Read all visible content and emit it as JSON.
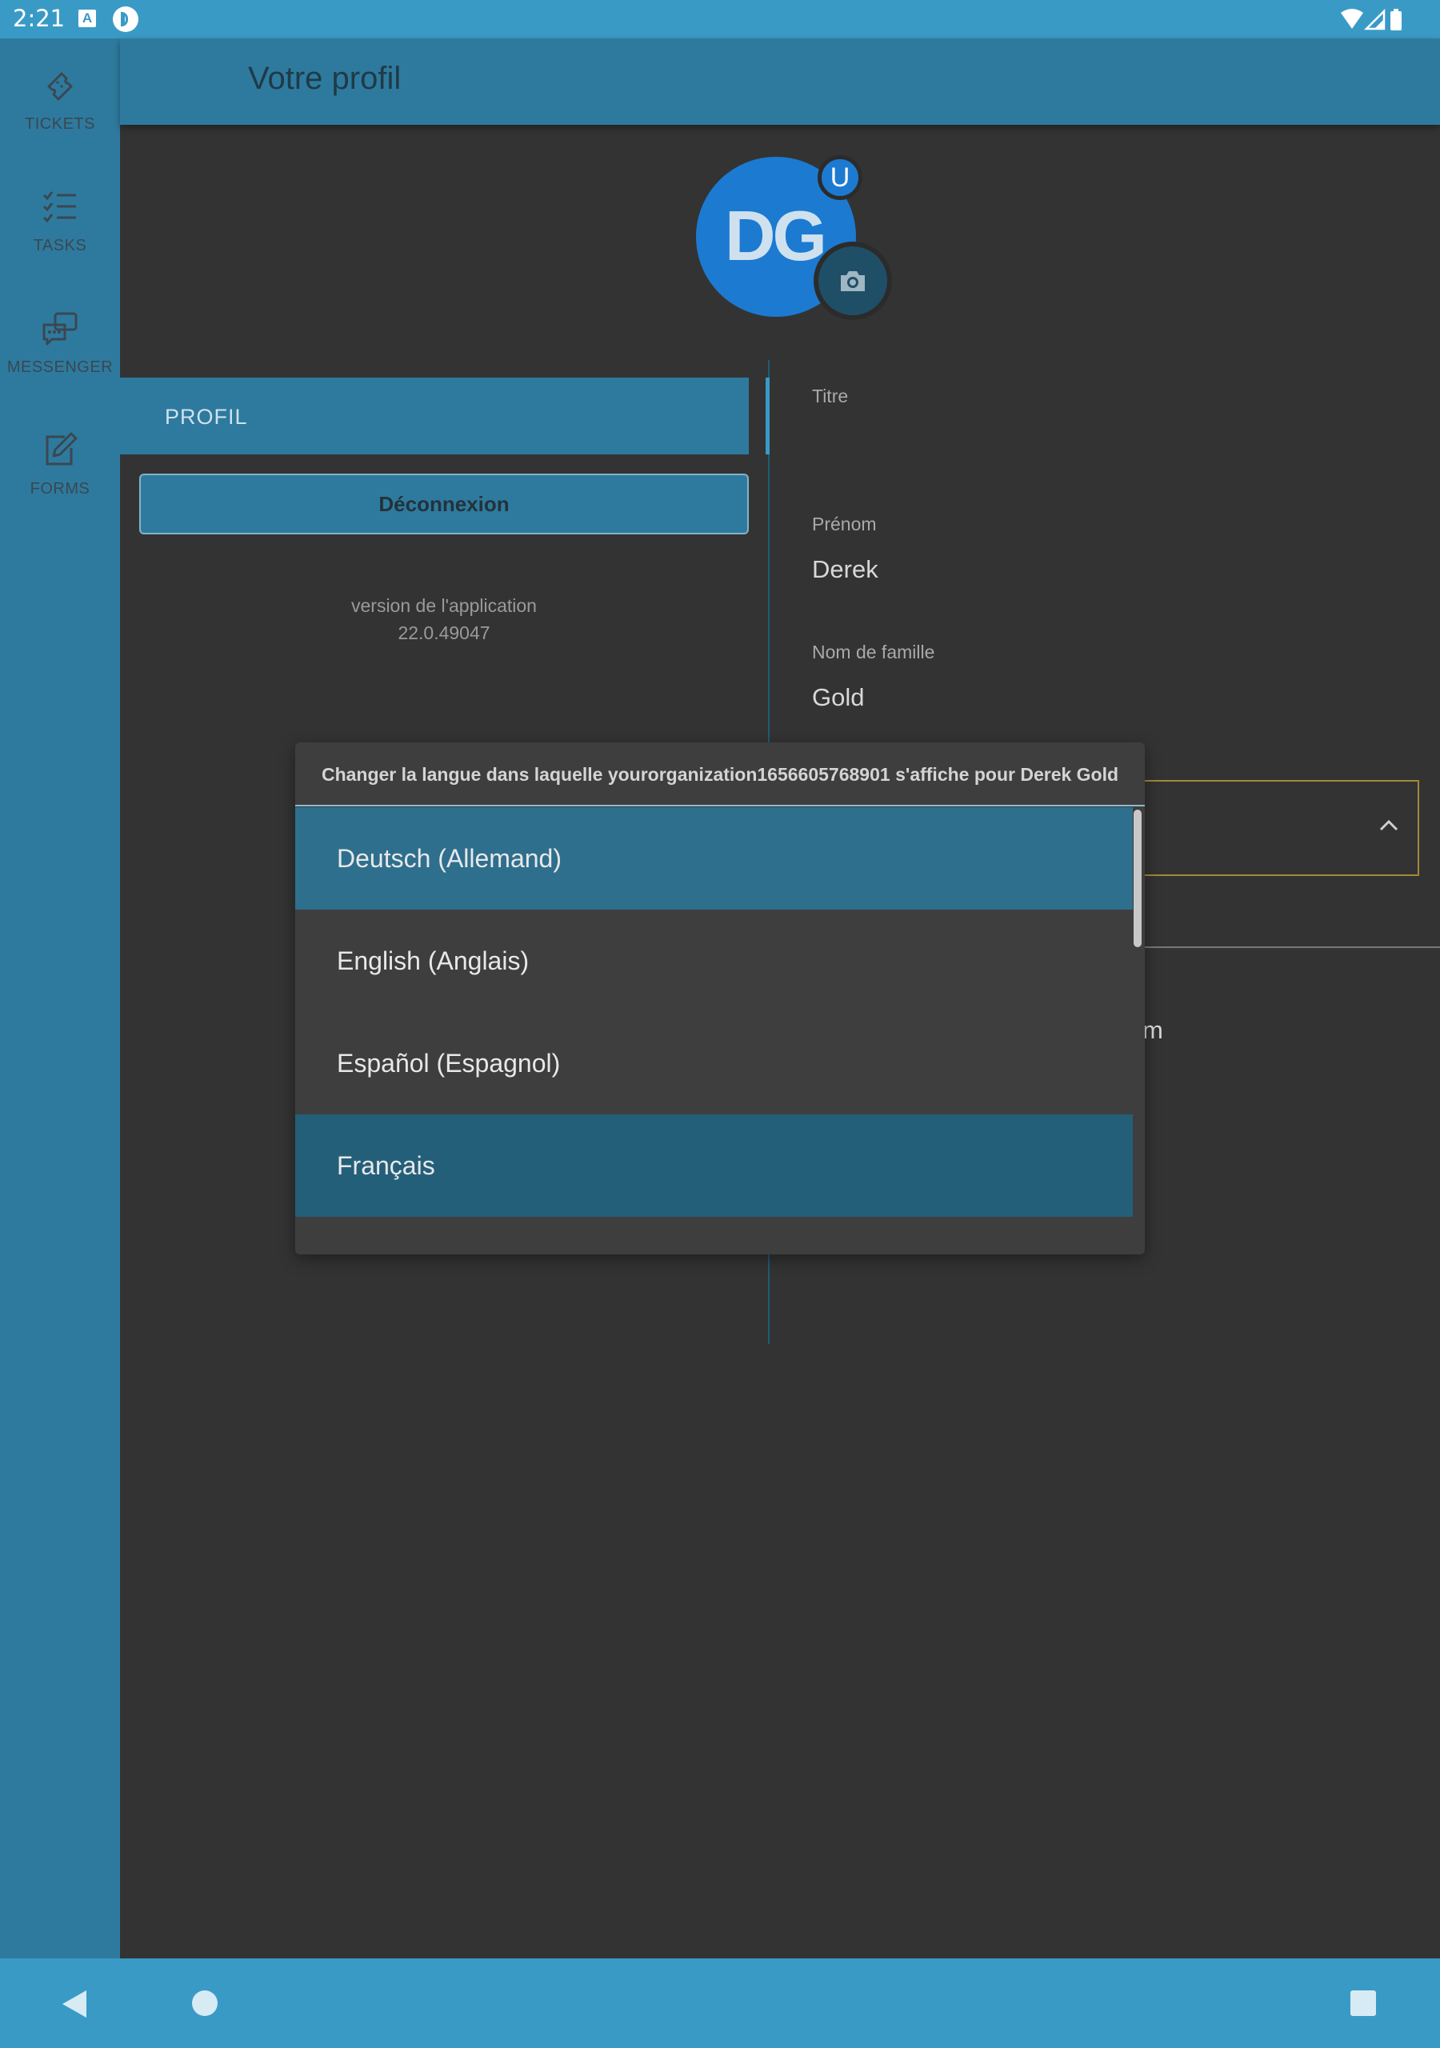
{
  "status_bar": {
    "time": "2:21",
    "notif_icons": [
      "a-box-icon",
      "app-notification-icon"
    ],
    "right_icons": [
      "wifi-icon",
      "signal-icon",
      "battery-icon"
    ]
  },
  "rail": {
    "items": [
      {
        "label": "TICKETS",
        "icon": "ticket-icon"
      },
      {
        "label": "TASKS",
        "icon": "checklist-icon"
      },
      {
        "label": "MESSENGER",
        "icon": "chat-icon"
      },
      {
        "label": "FORMS",
        "icon": "edit-icon"
      }
    ]
  },
  "header": {
    "title": "Votre profil"
  },
  "avatar": {
    "initials": "DG",
    "badge": "U"
  },
  "left_panel": {
    "tab_label": "PROFIL",
    "logout_label": "Déconnexion",
    "version_label": "version de l'application",
    "version_number": "22.0.49047"
  },
  "form": {
    "titre_label": "Titre",
    "prenom_label": "Prénom",
    "prenom_value": "Derek",
    "nom_label": "Nom de famille",
    "nom_value": "Gold",
    "partial_text": "m"
  },
  "language_popup": {
    "title": "Changer la langue dans laquelle yourorganization1656605768901 s'affiche pour Derek Gold",
    "options": [
      {
        "label": "Deutsch (Allemand)",
        "state": "highlighted"
      },
      {
        "label": "English (Anglais)",
        "state": "normal"
      },
      {
        "label": "Español (Espagnol)",
        "state": "normal"
      },
      {
        "label": "Français",
        "state": "selected"
      }
    ]
  },
  "colors": {
    "accent": "#2e7a9e",
    "status_bar": "#3a9ac6",
    "background": "#333333",
    "avatar": "#1c7ad1"
  }
}
